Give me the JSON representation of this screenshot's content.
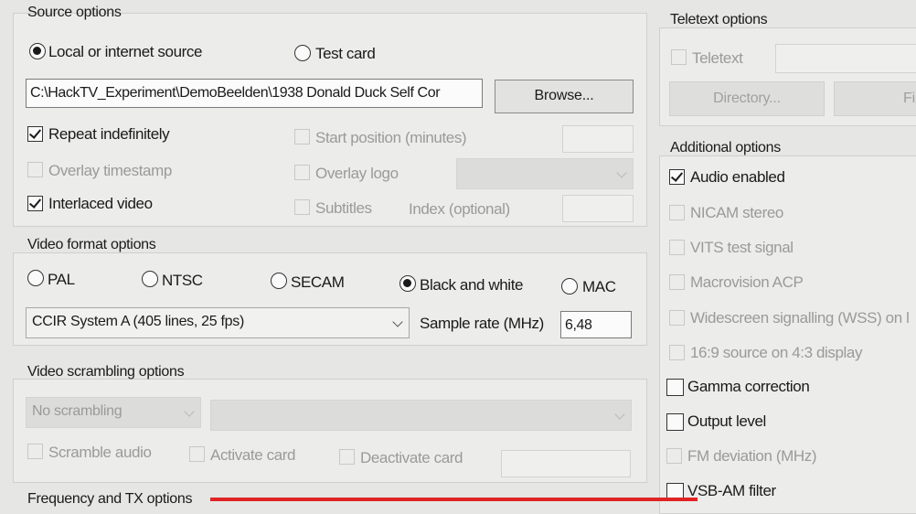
{
  "source": {
    "title": "Source options",
    "local_label": "Local or internet source",
    "testcard_label": "Test card",
    "path_value": "C:\\HackTV_Experiment\\DemoBeelden\\1938 Donald Duck Self Cor",
    "browse_label": "Browse...",
    "repeat_label": "Repeat indefinitely",
    "startpos_label": "Start position (minutes)",
    "overlay_ts_label": "Overlay timestamp",
    "overlay_logo_label": "Overlay logo",
    "interlaced_label": "Interlaced video",
    "subtitles_label": "Subtitles",
    "index_label": "Index (optional)"
  },
  "video_format": {
    "title": "Video format options",
    "pal_label": "PAL",
    "ntsc_label": "NTSC",
    "secam_label": "SECAM",
    "bw_label": "Black and white",
    "mac_label": "MAC",
    "system_value": "CCIR System A (405 lines, 25 fps)",
    "sample_rate_label": "Sample rate (MHz)",
    "sample_rate_value": "6,48"
  },
  "scrambling": {
    "title": "Video scrambling options",
    "mode_value": "No scrambling",
    "scramble_audio_label": "Scramble audio",
    "activate_label": "Activate card",
    "deactivate_label": "Deactivate card"
  },
  "frequency": {
    "title": "Frequency and TX options"
  },
  "teletext": {
    "title": "Teletext options",
    "teletext_label": "Teletext",
    "directory_label": "Directory...",
    "file_label": "File"
  },
  "additional": {
    "title": "Additional options",
    "audio_label": "Audio enabled",
    "nicam_label": "NICAM stereo",
    "vits_label": "VITS test signal",
    "macrovision_label": "Macrovision ACP",
    "wss_label": "Widescreen signalling (WSS) on l",
    "source169_label": "16:9 source on 4:3 display",
    "gamma_label": "Gamma correction",
    "output_label": "Output level",
    "fm_label": "FM deviation (MHz)",
    "vsb_label": "VSB-AM filter"
  },
  "colors": {
    "accent_line": "#e02424"
  }
}
